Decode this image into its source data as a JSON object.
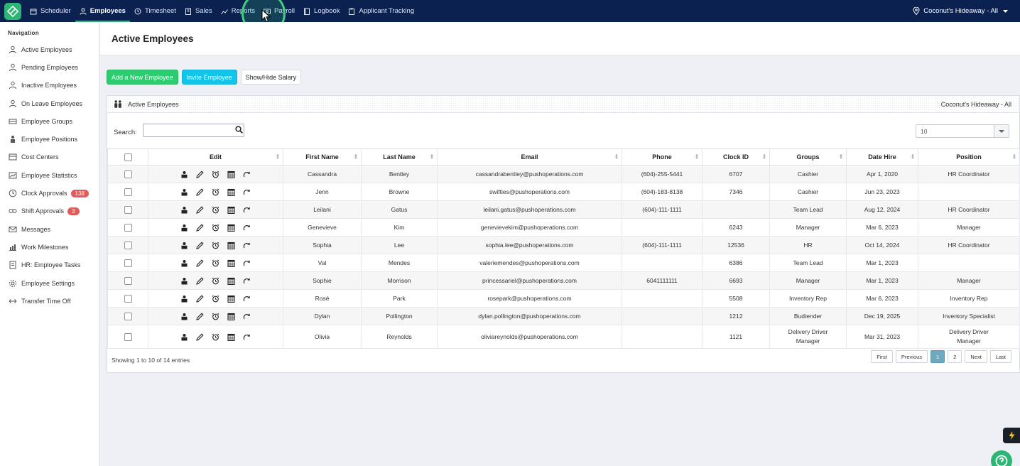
{
  "topnav": {
    "items": [
      {
        "label": "Scheduler",
        "icon": "calendar-icon"
      },
      {
        "label": "Employees",
        "icon": "person-icon",
        "active": true
      },
      {
        "label": "Timesheet",
        "icon": "clock-icon"
      },
      {
        "label": "Sales",
        "icon": "building-icon"
      },
      {
        "label": "Reports",
        "icon": "chart-line-icon"
      },
      {
        "label": "Payroll",
        "icon": "payroll-icon"
      },
      {
        "label": "Logbook",
        "icon": "book-icon"
      },
      {
        "label": "Applicant Tracking",
        "icon": "clipboard-icon"
      }
    ],
    "location": "Coconut's Hideaway - All"
  },
  "sidebar": {
    "heading": "Navigation",
    "items": [
      {
        "label": "Active Employees",
        "icon": "person-icon"
      },
      {
        "label": "Pending Employees",
        "icon": "person-pending-icon"
      },
      {
        "label": "Inactive Employees",
        "icon": "person-inactive-icon"
      },
      {
        "label": "On Leave Employees",
        "icon": "person-leave-icon"
      },
      {
        "label": "Employee Groups",
        "icon": "groups-icon"
      },
      {
        "label": "Employee Positions",
        "icon": "positions-icon"
      },
      {
        "label": "Cost Centers",
        "icon": "cost-center-icon"
      },
      {
        "label": "Employee Statistics",
        "icon": "statistics-icon"
      },
      {
        "label": "Clock Approvals",
        "icon": "clock-icon",
        "badge": "138"
      },
      {
        "label": "Shift Approvals",
        "icon": "shift-icon",
        "badge": "3"
      },
      {
        "label": "Messages",
        "icon": "envelope-icon"
      },
      {
        "label": "Work Milestones",
        "icon": "milestone-icon"
      },
      {
        "label": "HR: Employee Tasks",
        "icon": "tasks-icon"
      },
      {
        "label": "Employee Settings",
        "icon": "settings-icon"
      },
      {
        "label": "Transfer Time Off",
        "icon": "transfer-icon"
      }
    ]
  },
  "page": {
    "title": "Active Employees",
    "buttons": {
      "add": "Add a New Employee",
      "invite": "Invite Employee",
      "toggle_salary": "Show/Hide Salary"
    },
    "panel_title": "Active Employees",
    "panel_location": "Coconut's Hideaway - All",
    "search_label": "Search:",
    "search_value": "",
    "page_size": "10"
  },
  "table": {
    "columns": [
      "Edit",
      "First Name",
      "Last Name",
      "Email",
      "Phone",
      "Clock ID",
      "Groups",
      "Date Hire",
      "Position"
    ],
    "rows": [
      {
        "first": "Cassandra",
        "last": "Bentley",
        "email": "cassandrabentley@pushoperations.com",
        "phone": "(604)-255-5441",
        "clock": "6707",
        "groups": [
          "Cashier"
        ],
        "hire": "Apr 1, 2020",
        "position": [
          "HR Coordinator"
        ]
      },
      {
        "first": "Jenn",
        "last": "Browne",
        "email": "swifties@pushoperations.com",
        "phone": "(604)-183-8138",
        "clock": "7346",
        "groups": [
          "Cashier"
        ],
        "hire": "Jun 23, 2023",
        "position": [
          ""
        ]
      },
      {
        "first": "Leilani",
        "last": "Gatus",
        "email": "leilani.gatus@pushoperations.com",
        "phone": "(604)-111-1111",
        "clock": "",
        "groups": [
          "Team Lead"
        ],
        "hire": "Aug 12, 2024",
        "position": [
          "HR Coordinator"
        ]
      },
      {
        "first": "Genevieve",
        "last": "Kim",
        "email": "genevievekim@pushoperations.com",
        "phone": "",
        "clock": "6243",
        "groups": [
          "Manager"
        ],
        "hire": "Mar 6, 2023",
        "position": [
          "Manager"
        ]
      },
      {
        "first": "Sophia",
        "last": "Lee",
        "email": "sophia.lee@pushoperations.com",
        "phone": "(604)-111-1111",
        "clock": "12536",
        "groups": [
          "HR"
        ],
        "hire": "Oct 14, 2024",
        "position": [
          "HR Coordinator"
        ]
      },
      {
        "first": "Val",
        "last": "Mendes",
        "email": "valeriemendes@pushoperations.com",
        "phone": "",
        "clock": "6386",
        "groups": [
          "Team Lead"
        ],
        "hire": "Mar 1, 2023",
        "position": [
          ""
        ]
      },
      {
        "first": "Sophie",
        "last": "Morrison",
        "email": "princessariel@pushoperations.com",
        "phone": "6041111111",
        "clock": "6693",
        "groups": [
          "Manager"
        ],
        "hire": "Mar 1, 2023",
        "position": [
          "Manager"
        ]
      },
      {
        "first": "Rosé",
        "last": "Park",
        "email": "rosepark@pushoperations.com",
        "phone": "",
        "clock": "5508",
        "groups": [
          "Inventory Rep"
        ],
        "hire": "Mar 6, 2023",
        "position": [
          "Inventory Rep"
        ]
      },
      {
        "first": "Dylan",
        "last": "Pollington",
        "email": "dylan.pollington@pushoperations.com",
        "phone": "",
        "clock": "1212",
        "groups": [
          "Budtender"
        ],
        "hire": "Dec 19, 2025",
        "position": [
          "Inventory Specialist"
        ]
      },
      {
        "first": "Olivia",
        "last": "Reynolds",
        "email": "oliviareynolds@pushoperations.com",
        "phone": "",
        "clock": "1121",
        "groups": [
          "Delivery Driver",
          "Manager"
        ],
        "hire": "Mar 31, 2023",
        "position": [
          "Delivery Driver",
          "Manager"
        ]
      }
    ]
  },
  "footer": {
    "info": "Showing 1 to 10 of 14 entries",
    "pager": {
      "first": "First",
      "previous": "Previous",
      "pages": [
        "1",
        "2"
      ],
      "current": "1",
      "next": "Next",
      "last": "Last"
    }
  },
  "colors": {
    "topbar": "#0b2150",
    "brand_green": "#2bb673",
    "add_button": "#2ecc71",
    "invite_button": "#12c4ea",
    "badge_red": "#e05b5b",
    "pager_current": "#6fa9c1"
  }
}
